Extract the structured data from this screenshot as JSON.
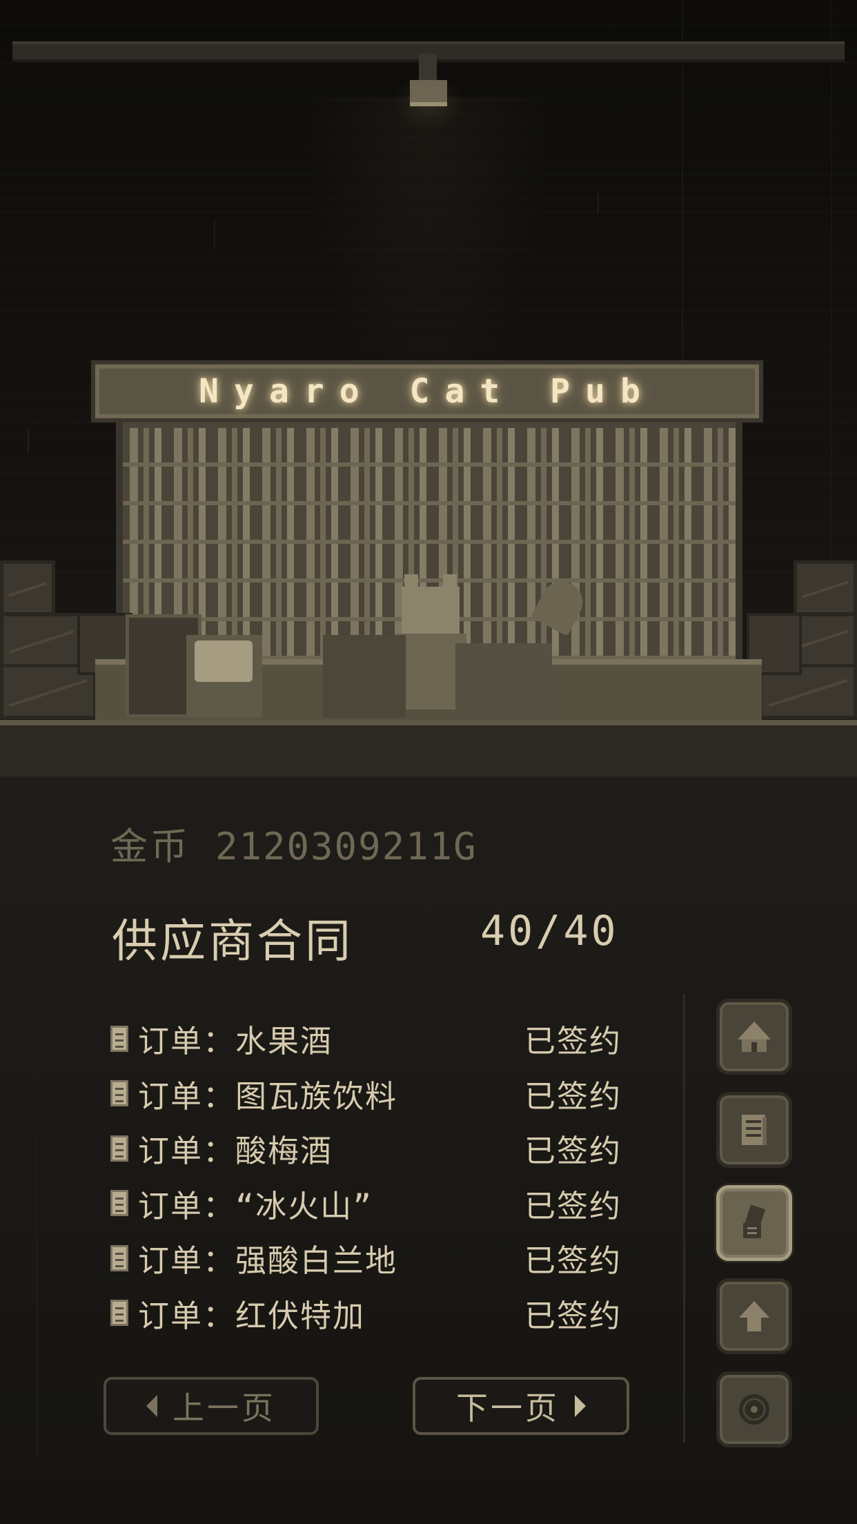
{
  "scene": {
    "sign_text": "Nyaro Cat Pub"
  },
  "wallet": {
    "label": "金币",
    "amount": "2120309211G"
  },
  "contracts": {
    "title": "供应商合同",
    "count": "40/40"
  },
  "orders": [
    {
      "text": "订单：水果酒",
      "status": "已签约"
    },
    {
      "text": "订单：图瓦族饮料",
      "status": "已签约"
    },
    {
      "text": "订单：酸梅酒",
      "status": "已签约"
    },
    {
      "text": "订单：“冰火山”",
      "status": "已签约"
    },
    {
      "text": "订单：强酸白兰地",
      "status": "已签约"
    },
    {
      "text": "订单：红伏特加",
      "status": "已签约"
    }
  ],
  "pager": {
    "prev_label": "上一页",
    "next_label": "下一页"
  },
  "side_menu": [
    {
      "icon": "house-icon",
      "active": false
    },
    {
      "icon": "document-icon",
      "active": false
    },
    {
      "icon": "contract-scroll-icon",
      "active": true
    },
    {
      "icon": "upgrade-arrow-icon",
      "active": false
    },
    {
      "icon": "record-disc-icon",
      "active": false
    }
  ],
  "colors": {
    "text_primary": "#d7cbaf",
    "text_dim": "#6f6856",
    "button_bg": "#4a4539",
    "button_active_border": "#a69c80",
    "background": "#0e0d0b"
  }
}
